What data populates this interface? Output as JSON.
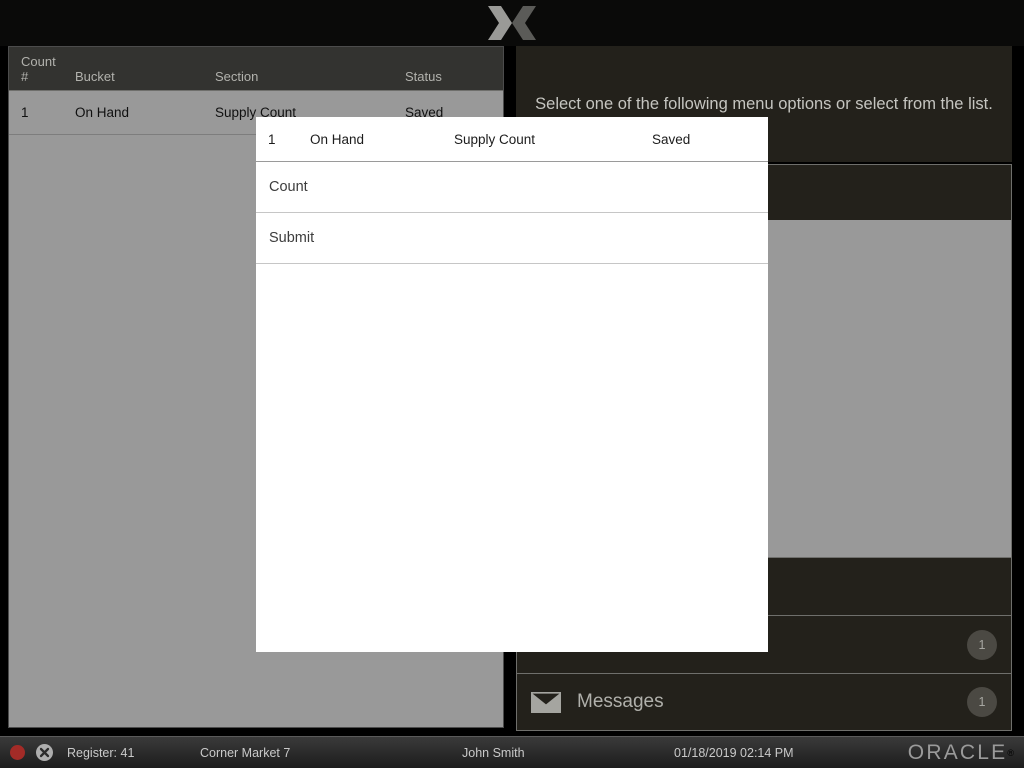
{
  "header": {
    "logo_icon": "brand-x-logo",
    "logo_left_color": "#9a9a97",
    "logo_right_color": "#5b5b58"
  },
  "count_table": {
    "columns": [
      "Count #",
      "Bucket",
      "Section",
      "Status"
    ],
    "column_num_line1": "Count",
    "column_num_line2": "#",
    "rows": [
      {
        "num": "1",
        "bucket": "On Hand",
        "section": "Supply Count",
        "status": "Saved"
      }
    ]
  },
  "right_panel": {
    "prompt": "Select one of the following menu options or select from the list.",
    "menu_items": [
      {
        "label": "",
        "icon": "",
        "badge": ""
      },
      {
        "label": "",
        "icon": "",
        "badge": "1"
      },
      {
        "label": "Messages",
        "icon": "envelope-icon",
        "badge": "1"
      }
    ]
  },
  "modal": {
    "selected_row": {
      "num": "1",
      "bucket": "On Hand",
      "section": "Supply Count",
      "status": "Saved"
    },
    "options": [
      {
        "label": "Count"
      },
      {
        "label": "Submit"
      }
    ]
  },
  "status_bar": {
    "record_icon": "record-dot-icon",
    "close_icon": "x-circle-icon",
    "register": "Register: 41",
    "store": "Corner Market 7",
    "user": "John Smith",
    "datetime": "01/18/2019 02:14 PM",
    "vendor": "ORACLE",
    "vendor_mark": "®"
  },
  "colors": {
    "panel_dark": "#23211b",
    "panel_gray": "#999999",
    "header_dark": "#333330",
    "accent_red": "#a32b27"
  }
}
